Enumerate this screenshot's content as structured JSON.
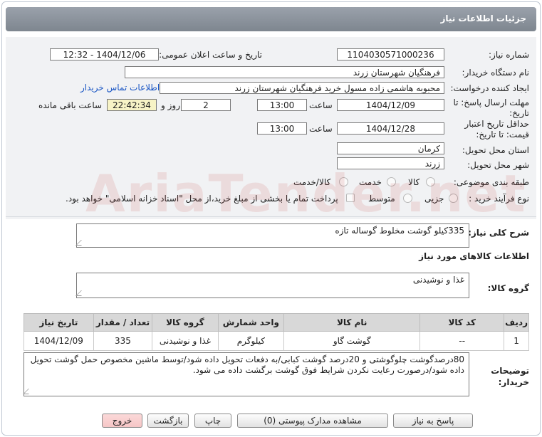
{
  "header": {
    "title": "جزئیات اطلاعات نیاز"
  },
  "form": {
    "need_number_label": "شماره نیاز:",
    "need_number": "1104030571000236",
    "announce_label": "تاریخ و ساعت اعلان عمومی:",
    "announce_value": "1404/12/06 - 12:32",
    "buyer_org_label": "نام دستگاه خریدار:",
    "buyer_org": "فرهنگیان شهرستان زرند",
    "requester_label": "ایجاد کننده درخواست:",
    "requester": "محبوبه هاشمی زاده مسول خرید فرهنگیان شهرستان زرند",
    "contact_link": "اطلاعات تماس خریدار",
    "deadline_label_1": "مهلت ارسال پاسخ: تا",
    "deadline_label_2": "تاریخ:",
    "deadline_date": "1404/12/09",
    "time_label": "ساعت",
    "deadline_time": "13:00",
    "days_value": "2",
    "days_label": "روز و",
    "remaining_time": "22:42:34",
    "remaining_label": "ساعت باقی مانده",
    "validity_label_1": "حداقل تاریخ اعتبار",
    "validity_label_2": "قیمت: تا تاریخ:",
    "validity_date": "1404/12/28",
    "validity_time": "13:00",
    "province_label": "استان محل تحویل:",
    "province": "کرمان",
    "city_label": "شهر محل تحویل:",
    "city": "زرند",
    "category_label": "طبقه بندی موضوعی:",
    "category_options": [
      "کالا",
      "خدمت",
      "کالا/خدمت"
    ],
    "process_label": "نوع فرآیند خرید :",
    "process_options": [
      "جزیی",
      "متوسط"
    ],
    "payment_note": "پرداخت تمام یا بخشی از مبلغ خرید،از محل \"اسناد خزانه اسلامی\" خواهد بود."
  },
  "summary": {
    "label": "شرح کلی نیاز:",
    "value": "335کیلو گوشت مخلوط گوساله تازه"
  },
  "goods_info": {
    "heading": "اطلاعات کالاهای مورد نیاز",
    "group_label": "گروه کالا:",
    "group_value": "غذا و نوشیدنی"
  },
  "table": {
    "headers": [
      "ردیف",
      "کد کالا",
      "نام کالا",
      "واحد شمارش",
      "گروه کالا",
      "تعداد / مقدار",
      "تاریخ نیاز"
    ],
    "rows": [
      [
        "1",
        "--",
        "گوشت گاو",
        "کیلوگرم",
        "غذا و نوشیدنی",
        "335",
        "1404/12/09"
      ]
    ]
  },
  "buyer_notes": {
    "label_1": "توضیحات",
    "label_2": "خریدار:",
    "value": "80درصدگوشت چلوگوشتی و 20درصد گوشت کبابی/به دفعات تحویل داده شود/توسط ماشین مخصوص حمل گوشت تحویل داده شود/درصورت رعایت نکردن شرایط فوق گوشت برگشت داده می شود."
  },
  "buttons": {
    "reply": "پاسخ به نیاز",
    "attachments": "مشاهده مدارک پیوستی (0)",
    "print": "چاپ",
    "back": "بازگشت",
    "exit": "خروج"
  },
  "watermark": "AriaTender.net",
  "colors": {
    "link": "#1a56c4",
    "highlight": "#f7f3c6",
    "exit_button": "#f6c6c6"
  }
}
